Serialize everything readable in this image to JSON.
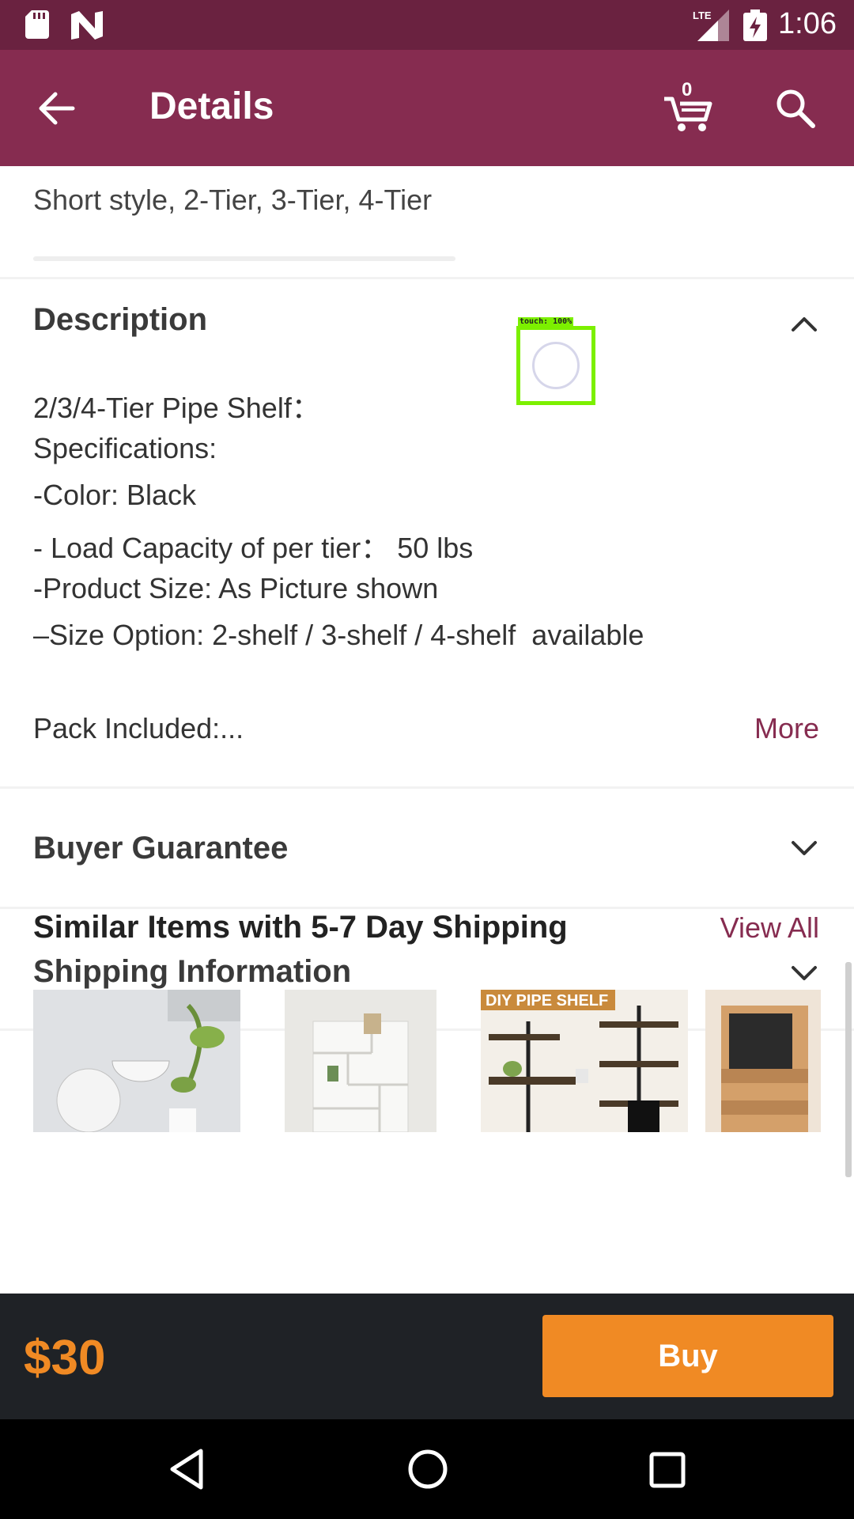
{
  "status_bar": {
    "time": "1:06",
    "network": "LTE",
    "icons": [
      "sd-card-icon",
      "n-notification-icon",
      "lte-signal-icon",
      "battery-charging-icon"
    ]
  },
  "app_bar": {
    "title": "Details",
    "cart_count": "0",
    "icons": [
      "back-arrow-icon",
      "cart-icon",
      "search-icon"
    ]
  },
  "product": {
    "variants_text": "Short style, 2-Tier, 3-Tier, 4-Tier"
  },
  "description": {
    "title": "Description",
    "lines": [
      "2/3/4-Tier Pipe Shelf：",
      "Specifications:",
      "-Color: Black",
      "- Load Capacity of per tier： 50 lbs",
      "-Product Size: As Picture shown",
      "–Size Option: 2-shelf / 3-shelf / 4-shelf  available"
    ],
    "pack_text": "Pack Included:...",
    "more_label": "More"
  },
  "sections": {
    "buyer_guarantee": "Buyer Guarantee",
    "shipping_information": "Shipping Information"
  },
  "similar": {
    "title": "Similar Items with 5-7 Day Shipping",
    "view_all_label": "View All",
    "thumbnail_3_text": "DIY PIPE SHELF"
  },
  "touch_overlay": {
    "label": "touch: 100%"
  },
  "buy_bar": {
    "price": "$30",
    "buy_label": "Buy"
  },
  "colors": {
    "status_bar": "#6a2240",
    "app_bar": "#862c50",
    "accent": "#862c50",
    "buy": "#f08a24",
    "buy_bar": "#1f2226"
  }
}
